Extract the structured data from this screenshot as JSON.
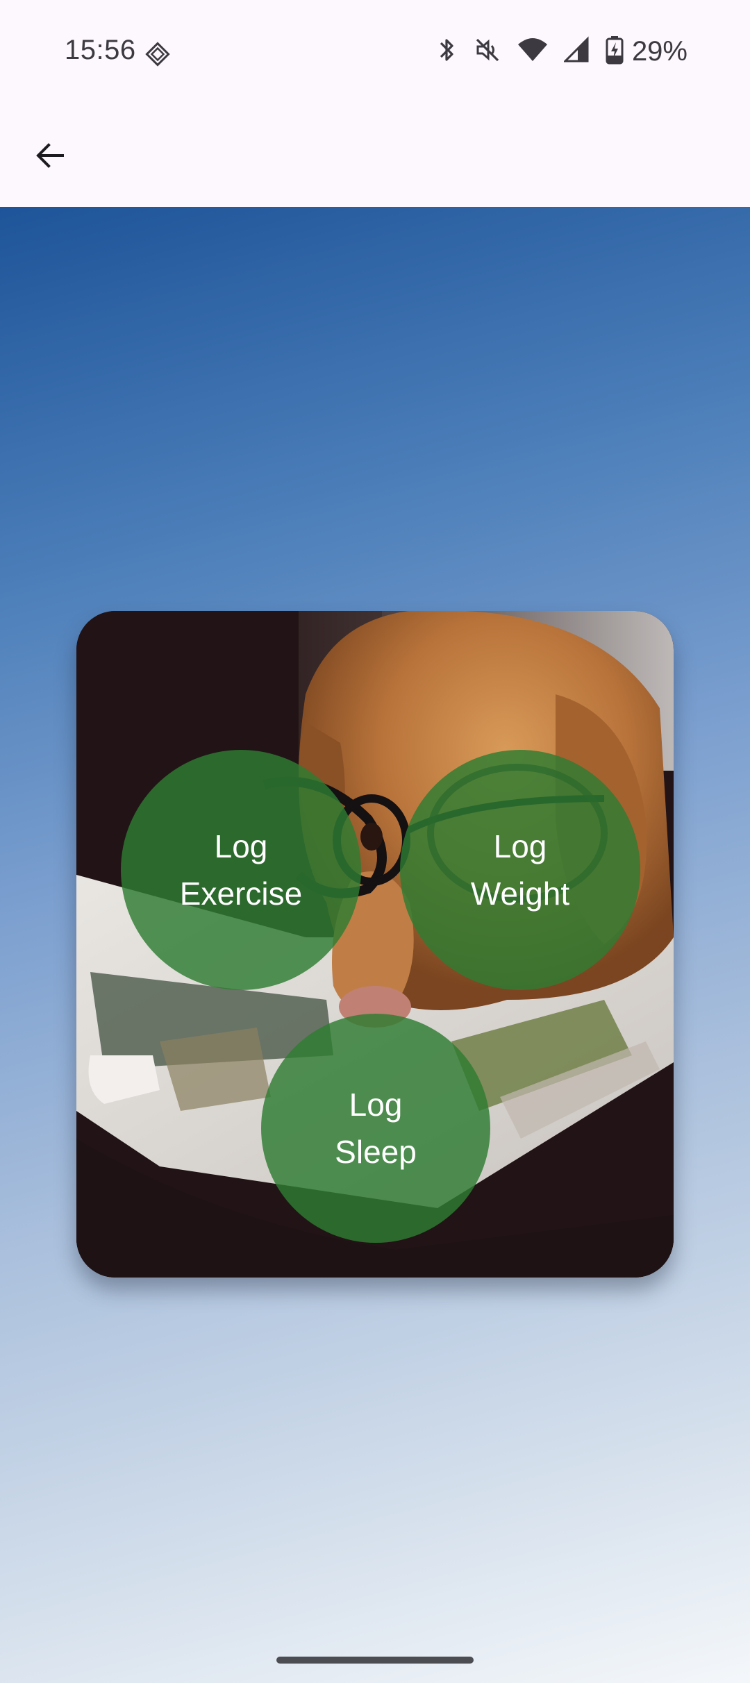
{
  "status_bar": {
    "time": "15:56",
    "icons": [
      "diamond-icon",
      "bluetooth-icon",
      "mute-icon",
      "wifi-icon",
      "signal-icon",
      "battery-charging-icon"
    ],
    "battery": "29%"
  },
  "app_bar": {
    "back_icon": "back-arrow-icon"
  },
  "card": {
    "image": "dog-with-glasses-reading-magazine",
    "buttons": {
      "exercise": {
        "line1": "Log",
        "line2": "Exercise"
      },
      "weight": {
        "line1": "Log",
        "line2": "Weight"
      },
      "sleep": {
        "line1": "Log",
        "line2": "Sleep"
      }
    },
    "button_color": "#2e7d32"
  },
  "colors": {
    "gradient_top": "#1e5499",
    "gradient_bottom": "#f4f7fa",
    "surface": "#fdf7fe"
  }
}
